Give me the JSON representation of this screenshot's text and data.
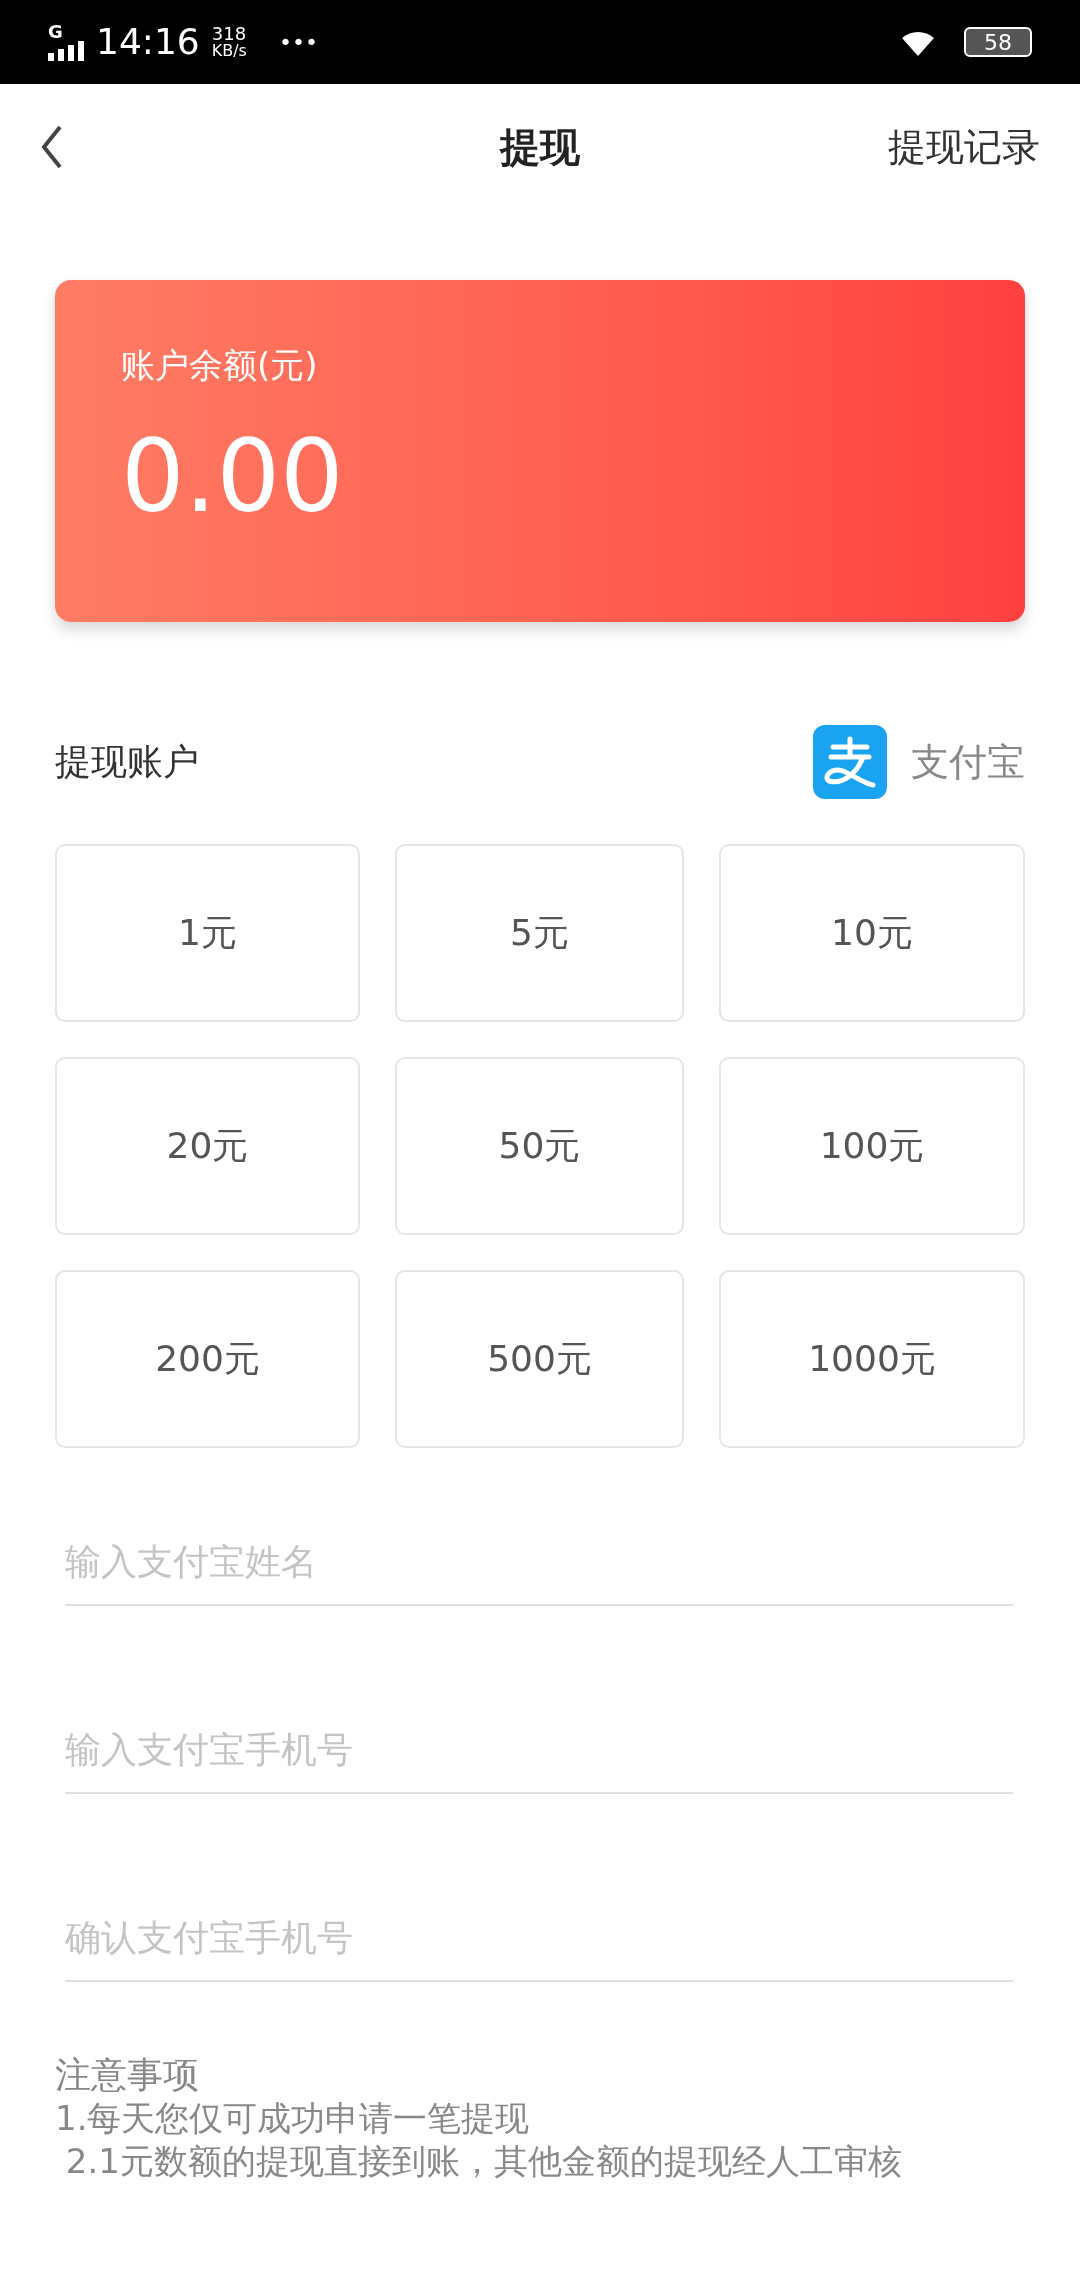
{
  "status_bar": {
    "time": "14:16",
    "network": "G",
    "speed_value": "318",
    "speed_unit": "KB/s",
    "more": "•••",
    "battery": "58"
  },
  "nav": {
    "title": "提现",
    "action": "提现记录"
  },
  "balance_card": {
    "label": "账户余额(元)",
    "amount": "0.00"
  },
  "account": {
    "label": "提现账户",
    "method": "支付宝"
  },
  "amounts": [
    {
      "label": "1元",
      "selected": false
    },
    {
      "label": "5元",
      "selected": false
    },
    {
      "label": "10元",
      "selected": false
    },
    {
      "label": "20元",
      "selected": false
    },
    {
      "label": "50元",
      "selected": false
    },
    {
      "label": "100元",
      "selected": false
    },
    {
      "label": "200元",
      "selected": false
    },
    {
      "label": "500元",
      "selected": false
    },
    {
      "label": "1000元",
      "selected": false
    }
  ],
  "fields": [
    {
      "placeholder": "输入支付宝姓名"
    },
    {
      "placeholder": "输入支付宝手机号"
    },
    {
      "placeholder": "确认支付宝手机号"
    }
  ],
  "notes": {
    "title": "注意事项",
    "lines": [
      "1.每天您仅可成功申请一笔提现",
      " 2.1元数额的提现直接到账，其他金额的提现经人工审核"
    ]
  }
}
